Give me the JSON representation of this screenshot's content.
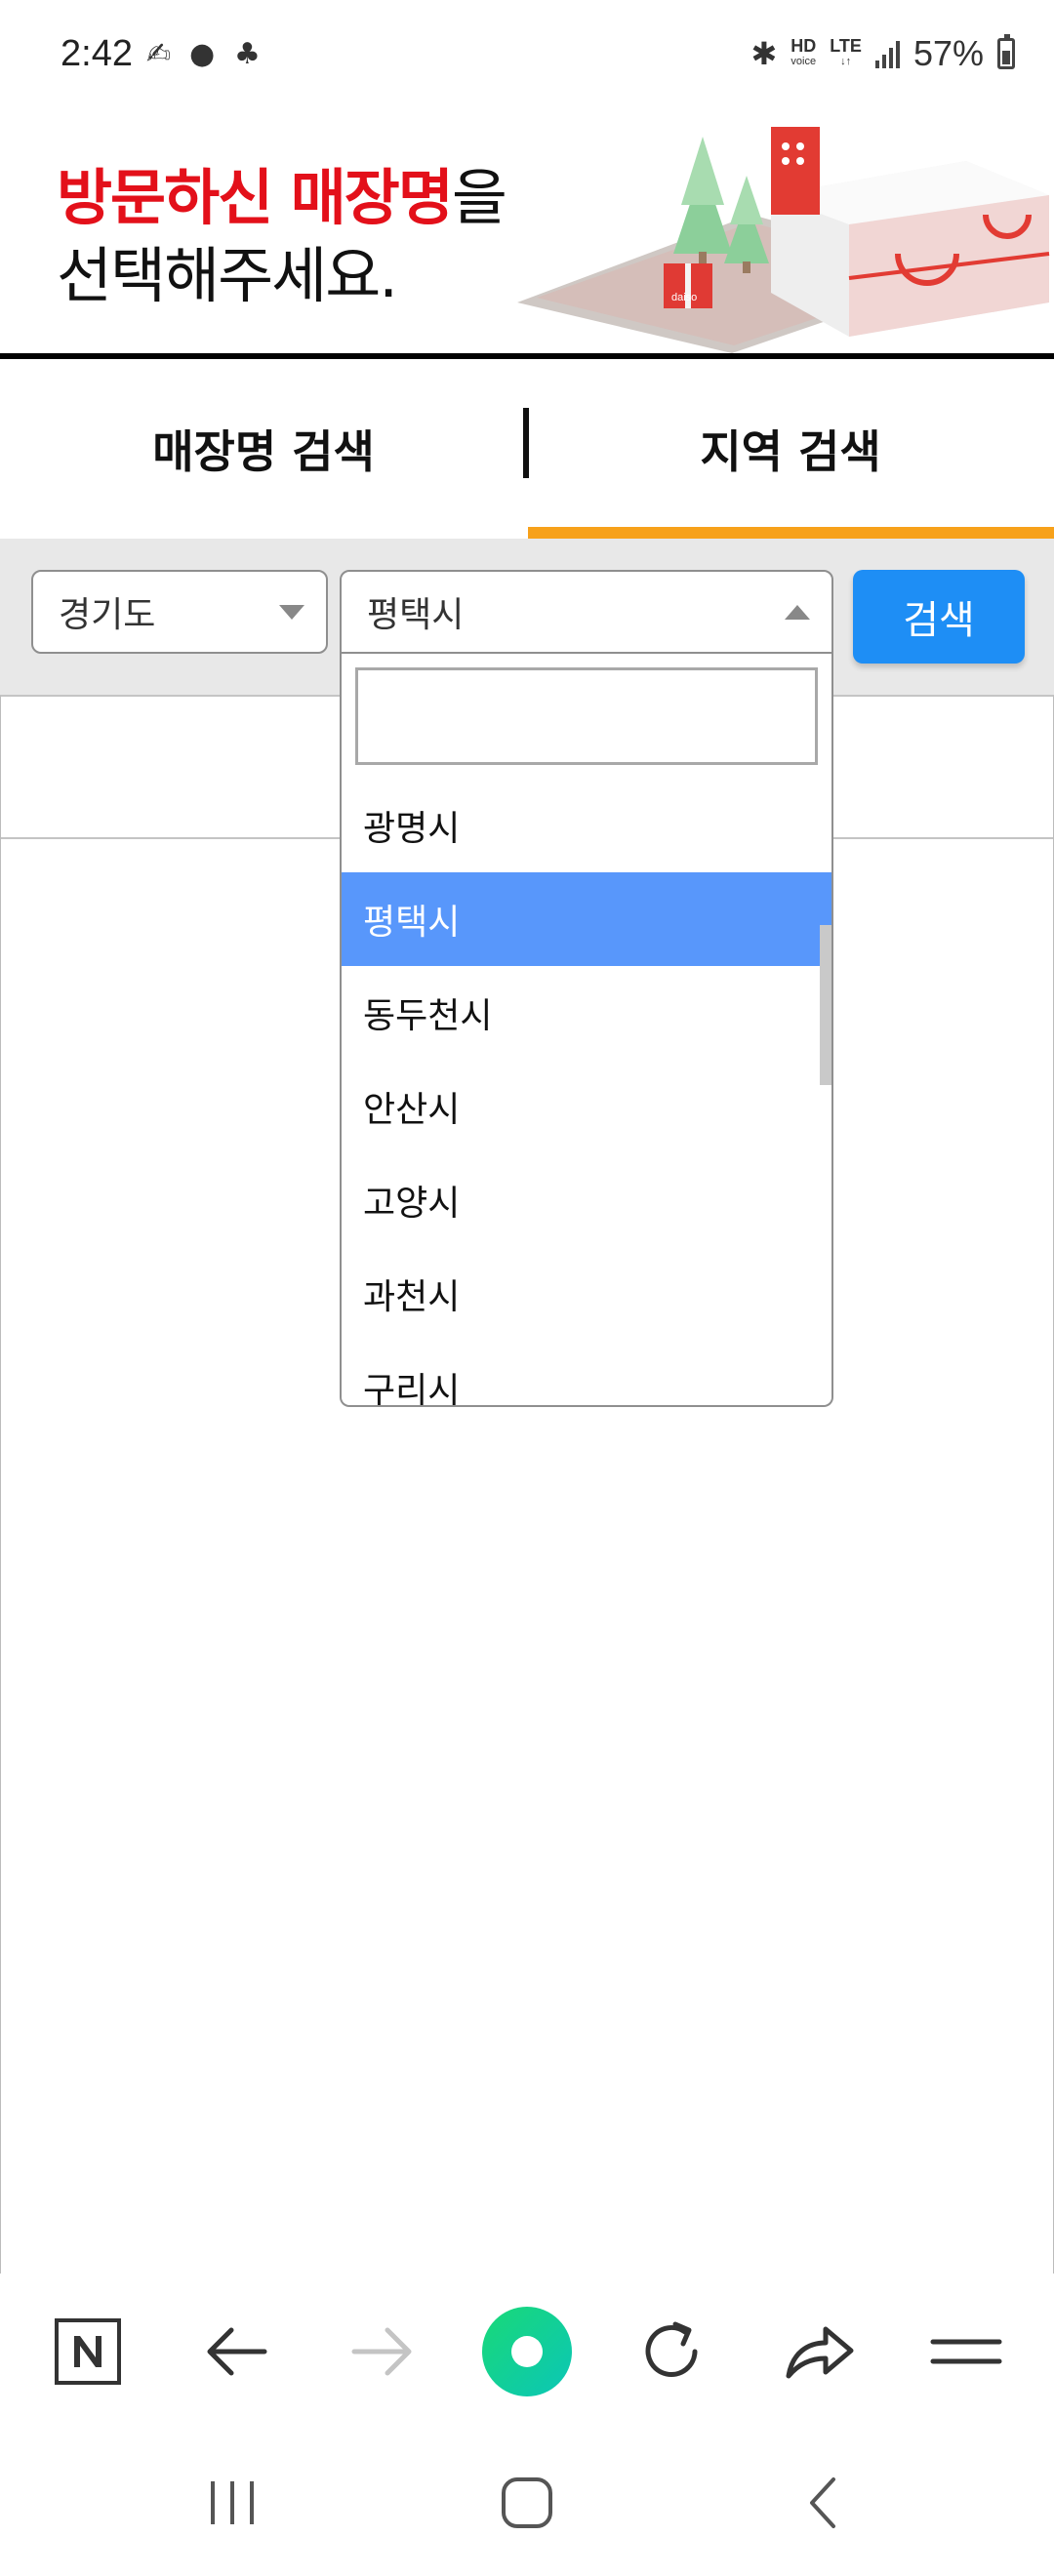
{
  "status_bar": {
    "time": "2:42",
    "network": "LTE",
    "hd_voice": "HD",
    "hd_voice_sub": "voice",
    "battery": "57%"
  },
  "banner": {
    "title_red": "방문하신 매장명",
    "title_suffix": "을",
    "title_line2": "선택해주세요.",
    "brand": "daiso"
  },
  "tabs": [
    {
      "label": "매장명 검색",
      "active": false
    },
    {
      "label": "지역 검색",
      "active": true
    }
  ],
  "filters": {
    "province": "경기도",
    "city": "평택시",
    "search_button": "검색"
  },
  "dropdown": {
    "search_value": "",
    "items": [
      {
        "label": "광명시",
        "selected": false
      },
      {
        "label": "평택시",
        "selected": true
      },
      {
        "label": "동두천시",
        "selected": false
      },
      {
        "label": "안산시",
        "selected": false
      },
      {
        "label": "고양시",
        "selected": false
      },
      {
        "label": "과천시",
        "selected": false
      },
      {
        "label": "구리시",
        "selected": false
      }
    ]
  },
  "browser_toolbar": {
    "icons": [
      "naver-icon",
      "back-arrow-icon",
      "forward-arrow-icon",
      "green-dot-icon",
      "refresh-icon",
      "share-icon",
      "menu-icon"
    ]
  },
  "system_nav": {
    "icons": [
      "recents-icon",
      "home-icon",
      "back-icon"
    ]
  },
  "colors": {
    "accent_orange": "#f7a11a",
    "search_blue": "#1e8ef5",
    "selected_blue": "#5897fb",
    "brand_red": "#e3101a",
    "green": "#19d977"
  }
}
